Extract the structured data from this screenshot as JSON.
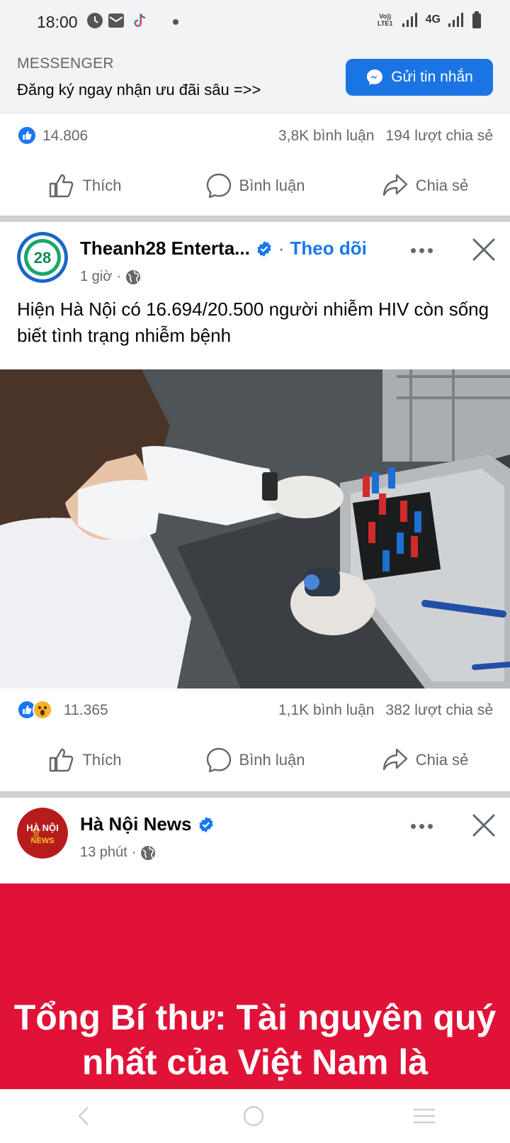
{
  "status_bar": {
    "time": "18:00",
    "volte": "Vo)) LTE1",
    "network": "4G"
  },
  "ad": {
    "source": "MESSENGER",
    "text": "Đăng ký ngay nhận ưu đãi sâu =>>",
    "button_label": "Gửi tin nhắn"
  },
  "post1": {
    "reactions": "14.806",
    "comments": "3,8K bình luận",
    "shares": "194 lượt chia sẻ"
  },
  "actions": {
    "like": "Thích",
    "comment": "Bình luận",
    "share": "Chia sẻ"
  },
  "post2": {
    "page_name": "Theanh28 Enterta...",
    "follow": "Theo dõi",
    "avatar_text": "28",
    "time": "1 giờ",
    "text": "Hiện Hà Nội có 16.694/20.500 người nhiễm HIV còn sống biết tình trạng nhiễm bệnh",
    "reactions": "11.365",
    "comments": "1,1K bình luận",
    "shares": "382 lượt chia sẻ"
  },
  "post3": {
    "page_name": "Hà Nội News",
    "avatar_line1": "HÀ NỘI",
    "avatar_line2": "NEWS",
    "time": "13 phút",
    "headline": "Tổng Bí thư: Tài nguyên quý nhất của Việt Nam là"
  },
  "colors": {
    "facebook_blue": "#1877f2",
    "messenger_button": "#1b74e4",
    "news_red": "#e11237"
  }
}
